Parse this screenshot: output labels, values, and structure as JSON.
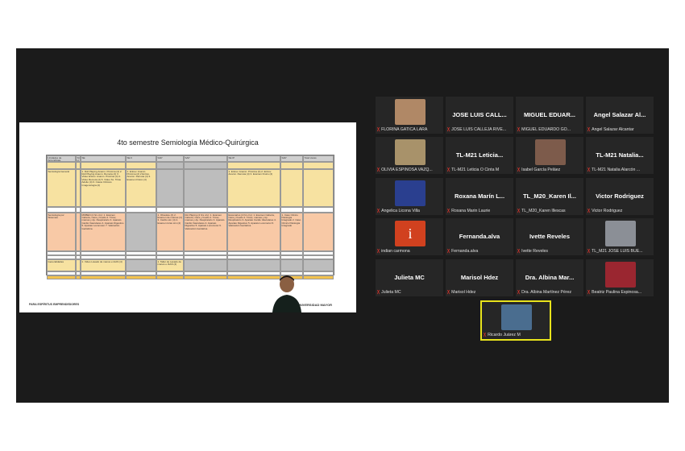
{
  "slide": {
    "title": "4to semestre Semiología Médico-Quirúrgica",
    "footer_left": "PARA ESPÍRITUS EMPRENDEDORES",
    "footer_brand": "UNIVERSIDAD MAYOR",
    "table": {
      "headers": [
        "Unidades de Aprendizaje",
        "SC H",
        "SE",
        "SE II",
        "SAP",
        "SAP",
        "SE IP",
        "SAP",
        "Total Horas"
      ],
      "row1_label": "Semiología General",
      "row1_c1": "1. Roll Playing Anamn. Próxima (4) 2. Roll Playing Anamn. Remota (4) 3. Video Entrev. Anamn. Próxima (4) 4. Video Remota (4) 5. Video Sx. Triste Adulto (4) 6. Casos Clínicos Imagenología (2)",
      "row1_c2": "1. Entrev. Anamn. Próxima (2) 2 Entrev. Anamn. Remota (4) 3. Examen Físico (4)",
      "row1_c6": "1. Entrev. Anamn. Próxima (4) 2. Entrev. Anamn. Remota (4) 3. Examen Físico (4)",
      "row2_label": "Semiología por Sistemas",
      "row2_c1": "MOBEN (4 hrs c/u): 1. Examen Cabeza, Cara y Cuello 2. Tórax, mamas y Ap. Respiratorio 3. Aparato Cardio Vasculares 4. Aparato Digestivo 5. Aparato Locomotor 7. Valoración Geriátrica",
      "row2_c3": "1. Obsolete (4) 2. Examen de mamas (4) 3. Cardio sim (4) 4. Examen tórax sim (4)",
      "row2_c5": "Rol Playing (4 hrs c/u): 1. Examen Cabeza, Cara y Cuello 2. Tórax, mamas y Ap. Respiratorio 3. Aparato Cardio Vasculares 4. Aparato Digestivo 5. Aparato Locomotor 6. Valoración Geriátrica",
      "row2_c6": "Escenarios (4 hrs c/u): 1. Examen Cabeza, Cara y Cuello 2. Tórax, mamas y Ap. Respiratorio 3. Aparato Cardio Vasculares 4. Aparato Digestivo 5. Aparato Locomotor 6. Valoración Geriátrica",
      "row2_c7": "1. Caso Clínico Patología Integrado 2. Caso Clínico Patología Integrado",
      "row3_label": "Generalidades",
      "row3_c1": "1. Video Lavado de manos e IAAS (4)",
      "row3_c3": "1. Taller de Lavado de manos e IAAS (4)"
    }
  },
  "participants": [
    {
      "tile_name": "",
      "caption": "FLORINA GATICA LARA",
      "photo": true,
      "photo_color": "#b08866"
    },
    {
      "tile_name": "JOSE LUIS CALL...",
      "caption": "JOSE LUIS CALLEJA RIVE...",
      "photo": false
    },
    {
      "tile_name": "MIGUEL EDUAR...",
      "caption": "MIGUEL EDUARDO GO...",
      "photo": false
    },
    {
      "tile_name": "Angel Salazar Al...",
      "caption": "Angel Salazar Alcantar",
      "photo": false
    },
    {
      "tile_name": "",
      "caption": "OLIVIA ESPINOSA VAZQ...",
      "photo": true,
      "photo_color": "#a8926a"
    },
    {
      "tile_name": "TL-M21 Leticia...",
      "caption": "TL-M21 Leticia O Cinta M",
      "photo": false
    },
    {
      "tile_name": "",
      "caption": "Isabel García Peláez",
      "photo": true,
      "photo_color": "#7d5b4b"
    },
    {
      "tile_name": "TL-M21 Natalia...",
      "caption": "TL-M21 Natalia Alarcón ...",
      "photo": false
    },
    {
      "tile_name": "",
      "caption": "Angelica Licona Villa",
      "photo": true,
      "photo_color": "#2a3f8f"
    },
    {
      "tile_name": "Roxana Marín L...",
      "caption": "Roxana Marin Laurie",
      "photo": false
    },
    {
      "tile_name": "TL_M20_Karen Il...",
      "caption": "TL_M20_Karen Illescas",
      "photo": false
    },
    {
      "tile_name": "Victor Rodriguez",
      "caption": "Victor Rodriguez",
      "photo": false
    },
    {
      "tile_name": "",
      "caption": "indian carmona",
      "photo": true,
      "photo_color": "#d1411f",
      "photo_letter": "i"
    },
    {
      "tile_name": "Fernanda.alva",
      "caption": "Fernanda.alva",
      "photo": false
    },
    {
      "tile_name": "Ivette Reveles",
      "caption": "Ivette Reveles",
      "photo": false
    },
    {
      "tile_name": "",
      "caption": "TL_M21 JOSE LUIS BUE...",
      "photo": true,
      "photo_color": "#8b8f96"
    },
    {
      "tile_name": "Julieta MC",
      "caption": "Julieta MC",
      "photo": false
    },
    {
      "tile_name": "Marisol Hdez",
      "caption": "Marisol Hdez",
      "photo": false
    },
    {
      "tile_name": "Dra. Albina Mar...",
      "caption": "Dra. Albina Martínez Pérez",
      "photo": false
    },
    {
      "tile_name": "",
      "caption": "Beatriz Paulina Espinosa...",
      "photo": true,
      "photo_color": "#9a2630"
    },
    {
      "tile_name": "",
      "caption": "Ricardo Juárez M",
      "photo": true,
      "photo_color": "#4a6d8f",
      "active": true
    }
  ],
  "colors": {
    "mic_muted": "#e0342b",
    "active_border": "#e8e31c",
    "background": "#1b1b1b"
  }
}
